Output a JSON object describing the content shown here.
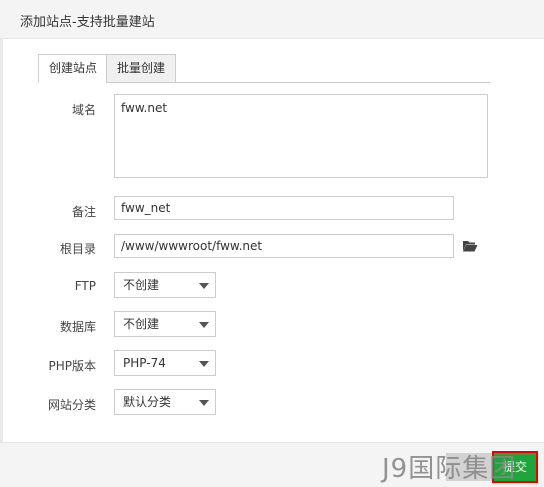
{
  "dialog": {
    "title": "添加站点-支持批量建站"
  },
  "tabs": [
    {
      "label": "创建站点",
      "active": true
    },
    {
      "label": "批量创建",
      "active": false
    }
  ],
  "form": {
    "domain": {
      "label": "域名",
      "value": "fww.net"
    },
    "note": {
      "label": "备注",
      "value": "fww_net"
    },
    "root": {
      "label": "根目录",
      "value": "/www/wwwroot/fww.net"
    },
    "ftp": {
      "label": "FTP",
      "value": "不创建"
    },
    "database": {
      "label": "数据库",
      "value": "不创建"
    },
    "php": {
      "label": "PHP版本",
      "value": "PHP-74"
    },
    "category": {
      "label": "网站分类",
      "value": "默认分类"
    }
  },
  "buttons": {
    "close": "",
    "submit": "提交"
  },
  "watermark": "J9国际集团",
  "colors": {
    "submit": "#20a53a",
    "highlight": "#e00000"
  }
}
